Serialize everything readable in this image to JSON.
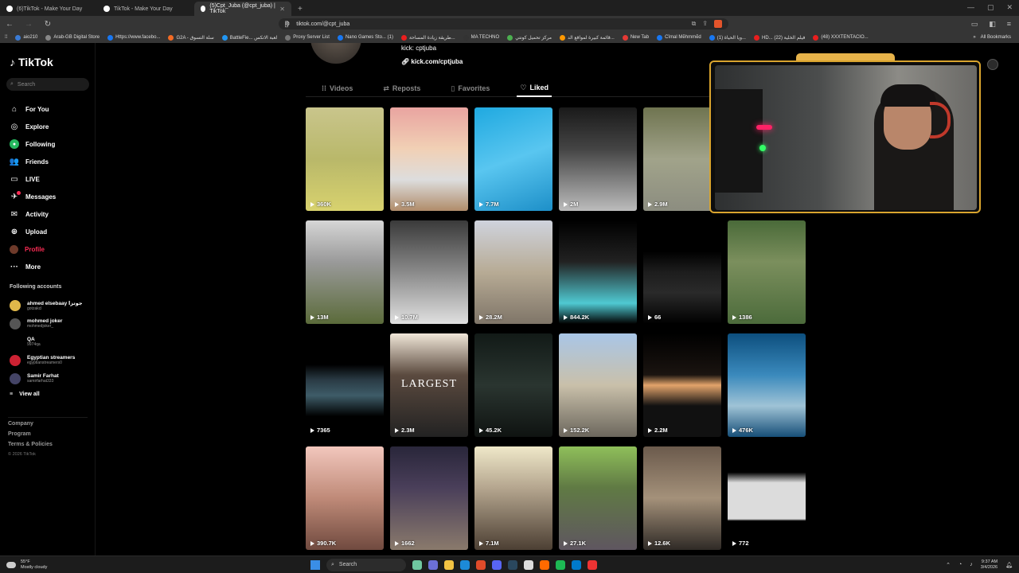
{
  "browser": {
    "tabs": [
      {
        "label": "(6)TikTok - Make Your Day",
        "active": false
      },
      {
        "label": "TikTok - Make Your Day",
        "active": false
      },
      {
        "label": "(5)Cpt_Juba (@cpt_juba) | TikTok",
        "active": true
      }
    ],
    "url": "tiktok.com/@cpt_juba",
    "bookmarks": [
      {
        "label": "aio210",
        "color": "#3a7bd5"
      },
      {
        "label": "Arab-GB Digital Store",
        "color": "#888"
      },
      {
        "label": "Https://www.facebo...",
        "color": "#1877f2"
      },
      {
        "label": "G2A - سلة التسوق",
        "color": "#f36b24"
      },
      {
        "label": "BattleFie... لعبة الاتكس",
        "color": "#2196f3"
      },
      {
        "label": "Proxy Server List",
        "color": "#777"
      },
      {
        "label": "Nano Games Sto... (1)",
        "color": "#1877f2"
      },
      {
        "label": "طريقة زيادة المساحة...",
        "color": "#e91e1e"
      },
      {
        "label": "MA TECHNO",
        "color": "#333"
      },
      {
        "label": "مركز تحميل كونتي",
        "color": "#4caf50"
      },
      {
        "label": "قائمة كبيرة لمواقع الد...",
        "color": "#ff9800"
      },
      {
        "label": "New Tab",
        "color": "#e53935"
      },
      {
        "label": "Cîmal Mẽhmmẽd",
        "color": "#1877f2"
      },
      {
        "label": "(1) ويا الحياة...",
        "color": "#1877f2"
      },
      {
        "label": "HD... فيلم الخلية (22)",
        "color": "#e91e1e"
      },
      {
        "label": "(48) XXXTENTACIO...",
        "color": "#e91e1e"
      }
    ],
    "all_bookmarks": "All Bookmarks"
  },
  "sidebar": {
    "logo": "TikTok",
    "search_placeholder": "Search",
    "nav": [
      {
        "label": "For You",
        "icon": "home-icon",
        "glyph": "⌂"
      },
      {
        "label": "Explore",
        "icon": "compass-icon",
        "glyph": "◎"
      },
      {
        "label": "Following",
        "icon": "following-icon",
        "glyph": "●"
      },
      {
        "label": "Friends",
        "icon": "friends-icon",
        "glyph": "👥"
      },
      {
        "label": "LIVE",
        "icon": "live-icon",
        "glyph": "▭"
      },
      {
        "label": "Messages",
        "icon": "messages-icon",
        "glyph": "✈"
      },
      {
        "label": "Activity",
        "icon": "activity-icon",
        "glyph": "✉"
      },
      {
        "label": "Upload",
        "icon": "upload-icon",
        "glyph": "⊕"
      },
      {
        "label": "Profile",
        "icon": "profile-icon",
        "glyph": ""
      },
      {
        "label": "More",
        "icon": "more-icon",
        "glyph": "···"
      }
    ],
    "following_title": "Following accounts",
    "following": [
      {
        "name": "ahmed elsebaay جوتزا",
        "handle": "gotzakcl",
        "color": "#e0b84a"
      },
      {
        "name": "mohmed joker",
        "handle": "mohmedjoker_",
        "color": "#555"
      },
      {
        "name": "QA",
        "handle": "9974qa",
        "color": "#000"
      },
      {
        "name": "Egyptian streamers",
        "handle": "egyptianstreamers0",
        "color": "#c23"
      },
      {
        "name": "Samir Farhat",
        "handle": "samirfarhat333",
        "color": "#446"
      }
    ],
    "view_all": "View all",
    "footer": [
      "Company",
      "Program",
      "Terms & Policies"
    ],
    "copyright": "© 2026 TikTok"
  },
  "profile": {
    "kick_text": "kick: cptjuba",
    "link": "kick.com/cptjuba",
    "tabs": [
      {
        "label": "Videos",
        "icon": "grid-icon",
        "glyph": "⁞⁞"
      },
      {
        "label": "Reposts",
        "icon": "repost-icon",
        "glyph": "⇄"
      },
      {
        "label": "Favorites",
        "icon": "bookmark-icon",
        "glyph": "▯"
      },
      {
        "label": "Liked",
        "icon": "heart-icon",
        "glyph": "♡",
        "active": true
      }
    ]
  },
  "videos": [
    {
      "count": "360K",
      "bg": "linear-gradient(180deg,#c9c58c,#b9b86a 50%,#d8d26e)",
      "caption": ""
    },
    {
      "count": "3.5M",
      "bg": "linear-gradient(180deg,#e9a4a0,#f1d0b5 40%,#ddd 70%,#b08c6a)",
      "caption": ""
    },
    {
      "count": "7.7M",
      "bg": "linear-gradient(160deg,#1fa9e0,#59c6f0 50%,#1d8fc8)",
      "caption": ""
    },
    {
      "count": "2M",
      "bg": "linear-gradient(180deg,#1a1a1a,#444 40%,#bcbcbc)",
      "caption": ""
    },
    {
      "count": "2.9M",
      "bg": "linear-gradient(180deg,#6f7450,#a1a38a 50%,#8c8d80)",
      "caption": ""
    },
    {
      "count": "",
      "bg": "#000",
      "caption": ""
    },
    {
      "count": "13M",
      "bg": "linear-gradient(180deg,#d6d6d6,#9a9a9a 40%,#5b6b3a)",
      "caption": ""
    },
    {
      "count": "10.7M",
      "bg": "linear-gradient(180deg,#3a3a3a,#8a8a8a 50%,#e0e0e0)",
      "caption": ""
    },
    {
      "count": "28.2M",
      "bg": "linear-gradient(180deg,#cfd3dd,#b7ab95 50%,#7f7568)",
      "caption": ""
    },
    {
      "count": "844.2K",
      "bg": "linear-gradient(180deg,#000,#222 40%,#4fc9d2 80%,#000)",
      "caption": ""
    },
    {
      "count": "66",
      "bg": "linear-gradient(180deg,#000 30%,#1d1d1d 50%,#2a2a2a 70%,#000)",
      "caption": ""
    },
    {
      "count": "1386",
      "bg": "linear-gradient(180deg,#4a6a39,#7b8f5d 40%,#4c6b3b)",
      "caption": ""
    },
    {
      "count": "7365",
      "bg": "linear-gradient(180deg,#000 30%,#2a3b45 45%,#3e5c68 60%,#000 80%)",
      "caption": ""
    },
    {
      "count": "2.3M",
      "bg": "linear-gradient(180deg,#f0e6d8,#5b4a3f 40%,#222)",
      "caption": "LARGEST"
    },
    {
      "count": "45.2K",
      "bg": "linear-gradient(180deg,#121a17,#2a3530 50%,#0f1311)",
      "caption": ""
    },
    {
      "count": "152.2K",
      "bg": "linear-gradient(180deg,#a9c6e7,#c9c0aa 50%,#6c675d)",
      "caption": ""
    },
    {
      "count": "2.2M",
      "bg": "linear-gradient(180deg,#000,#1a1410 40%,#e3a46b 50%,#111 70%)",
      "caption": ""
    },
    {
      "count": "476K",
      "bg": "linear-gradient(180deg,#0d4f7e,#3a89bc 40%,#9fc3d6 70%,#174f78)",
      "caption": ""
    },
    {
      "count": "390.7K",
      "bg": "linear-gradient(180deg,#f2c7bd,#bf8a78 50%,#704a3f)",
      "caption": ""
    },
    {
      "count": "1662",
      "bg": "linear-gradient(180deg,#29263a,#4a3f5a 40%,#8a7a6c)",
      "caption": ""
    },
    {
      "count": "7.1M",
      "bg": "linear-gradient(180deg,#efe8c9,#b5a68f 40%,#4c3f33)",
      "caption": ""
    },
    {
      "count": "27.1K",
      "bg": "linear-gradient(180deg,#8fbf5a,#607a44 40%,#5f5660)",
      "caption": ""
    },
    {
      "count": "12.6K",
      "bg": "linear-gradient(180deg,#6b5a4c,#a4917a 50%,#2f2a26)",
      "caption": ""
    },
    {
      "count": "772",
      "bg": "linear-gradient(180deg,#000 25%,#dcdcdc 35%,#dcdcdc 70%,#000 72%)",
      "caption": ""
    }
  ],
  "taskbar": {
    "temp": "55°F",
    "weather": "Mostly cloudy",
    "search": "Search",
    "time": "9:37 AM",
    "date": "3/4/2026"
  }
}
